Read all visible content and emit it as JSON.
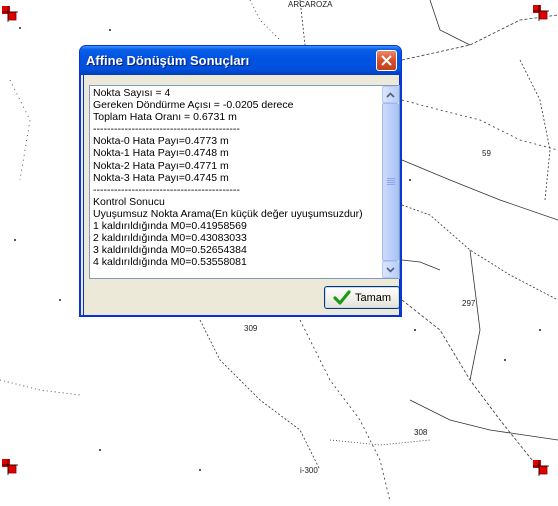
{
  "map": {
    "labels": {
      "top": "ARCAROZA",
      "n309": "309",
      "n308": "308",
      "n300": "i-300",
      "n59": "59",
      "n297": "297"
    }
  },
  "dialog": {
    "title": "Affine Dönüşüm Sonuçları",
    "lines": [
      "Nokta Sayısı = 4",
      "Gereken Döndürme Açısı = -0.0205 derece",
      "Toplam Hata Oranı = 0.6731 m",
      "------------------------------------------",
      "Nokta-0 Hata Payı=0.4773 m",
      "Nokta-1 Hata Payı=0.4748 m",
      "Nokta-2 Hata Payı=0.4771 m",
      "Nokta-3 Hata Payı=0.4745 m",
      "------------------------------------------",
      "Kontrol Sonucu",
      "Uyuşumsuz Nokta Arama(En küçük değer uyuşumsuzdur)",
      "1 kaldırıldığında M0=0.41958569",
      "2 kaldırıldığında M0=0.43083033",
      "3 kaldırıldığında M0=0.52654384",
      "4 kaldırıldığında M0=0.53558081"
    ],
    "ok_label": "Tamam"
  },
  "colors": {
    "title_bar": "#0054e3",
    "close_button": "#d8502c",
    "marker_red": "#e00000"
  },
  "icons": {
    "close": "close-icon",
    "ok": "checkmark-icon",
    "scroll_up": "arrow-up-icon",
    "scroll_down": "arrow-down-icon"
  }
}
